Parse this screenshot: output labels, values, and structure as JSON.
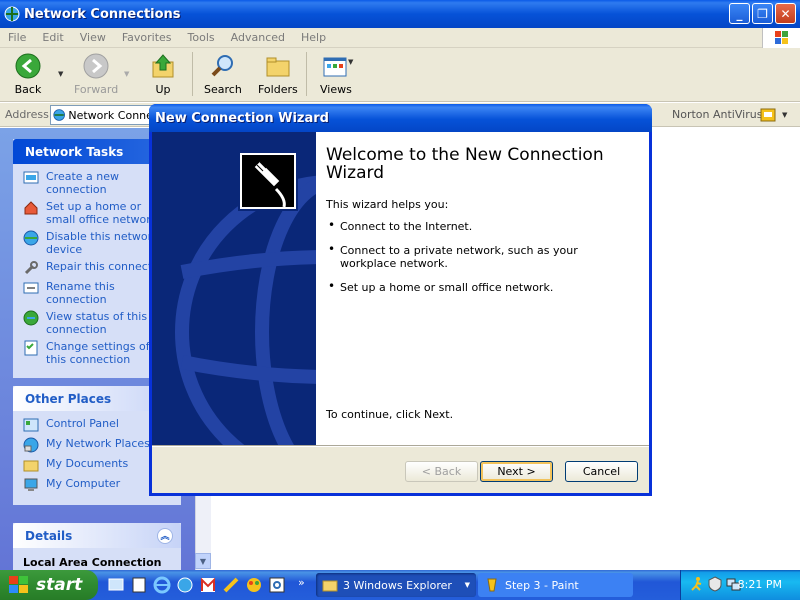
{
  "window": {
    "title": "Network Connections"
  },
  "menu": [
    "File",
    "Edit",
    "View",
    "Favorites",
    "Tools",
    "Advanced",
    "Help"
  ],
  "toolbar": {
    "back": "Back",
    "forward": "Forward",
    "up": "Up",
    "search": "Search",
    "folders": "Folders",
    "views": "Views"
  },
  "address": {
    "label": "Address",
    "value": "Network Connections",
    "norton": "Norton AntiVirus"
  },
  "network_tasks": {
    "title": "Network Tasks",
    "items": [
      "Create a new connection",
      "Set up a home or small office network",
      "Disable this network device",
      "Repair this connection",
      "Rename this connection",
      "View status of this connection",
      "Change settings of this connection"
    ]
  },
  "other_places": {
    "title": "Other Places",
    "items": [
      "Control Panel",
      "My Network Places",
      "My Documents",
      "My Computer"
    ]
  },
  "details": {
    "title": "Details",
    "subtitle": "Local Area Connection"
  },
  "wizard": {
    "title": "New Connection Wizard",
    "heading": "Welcome to the New Connection Wizard",
    "intro": "This wizard helps you:",
    "bullets": [
      "Connect to the Internet.",
      "Connect to a private network, such as your workplace network.",
      "Set up a home or small office network."
    ],
    "continue": "To continue, click Next.",
    "back_btn": "< Back",
    "next_btn": "Next >",
    "cancel_btn": "Cancel"
  },
  "taskbar": {
    "start": "start",
    "explorer": "3 Windows Explorer",
    "paint": "Step 3 - Paint",
    "clock": "8:21 PM"
  }
}
